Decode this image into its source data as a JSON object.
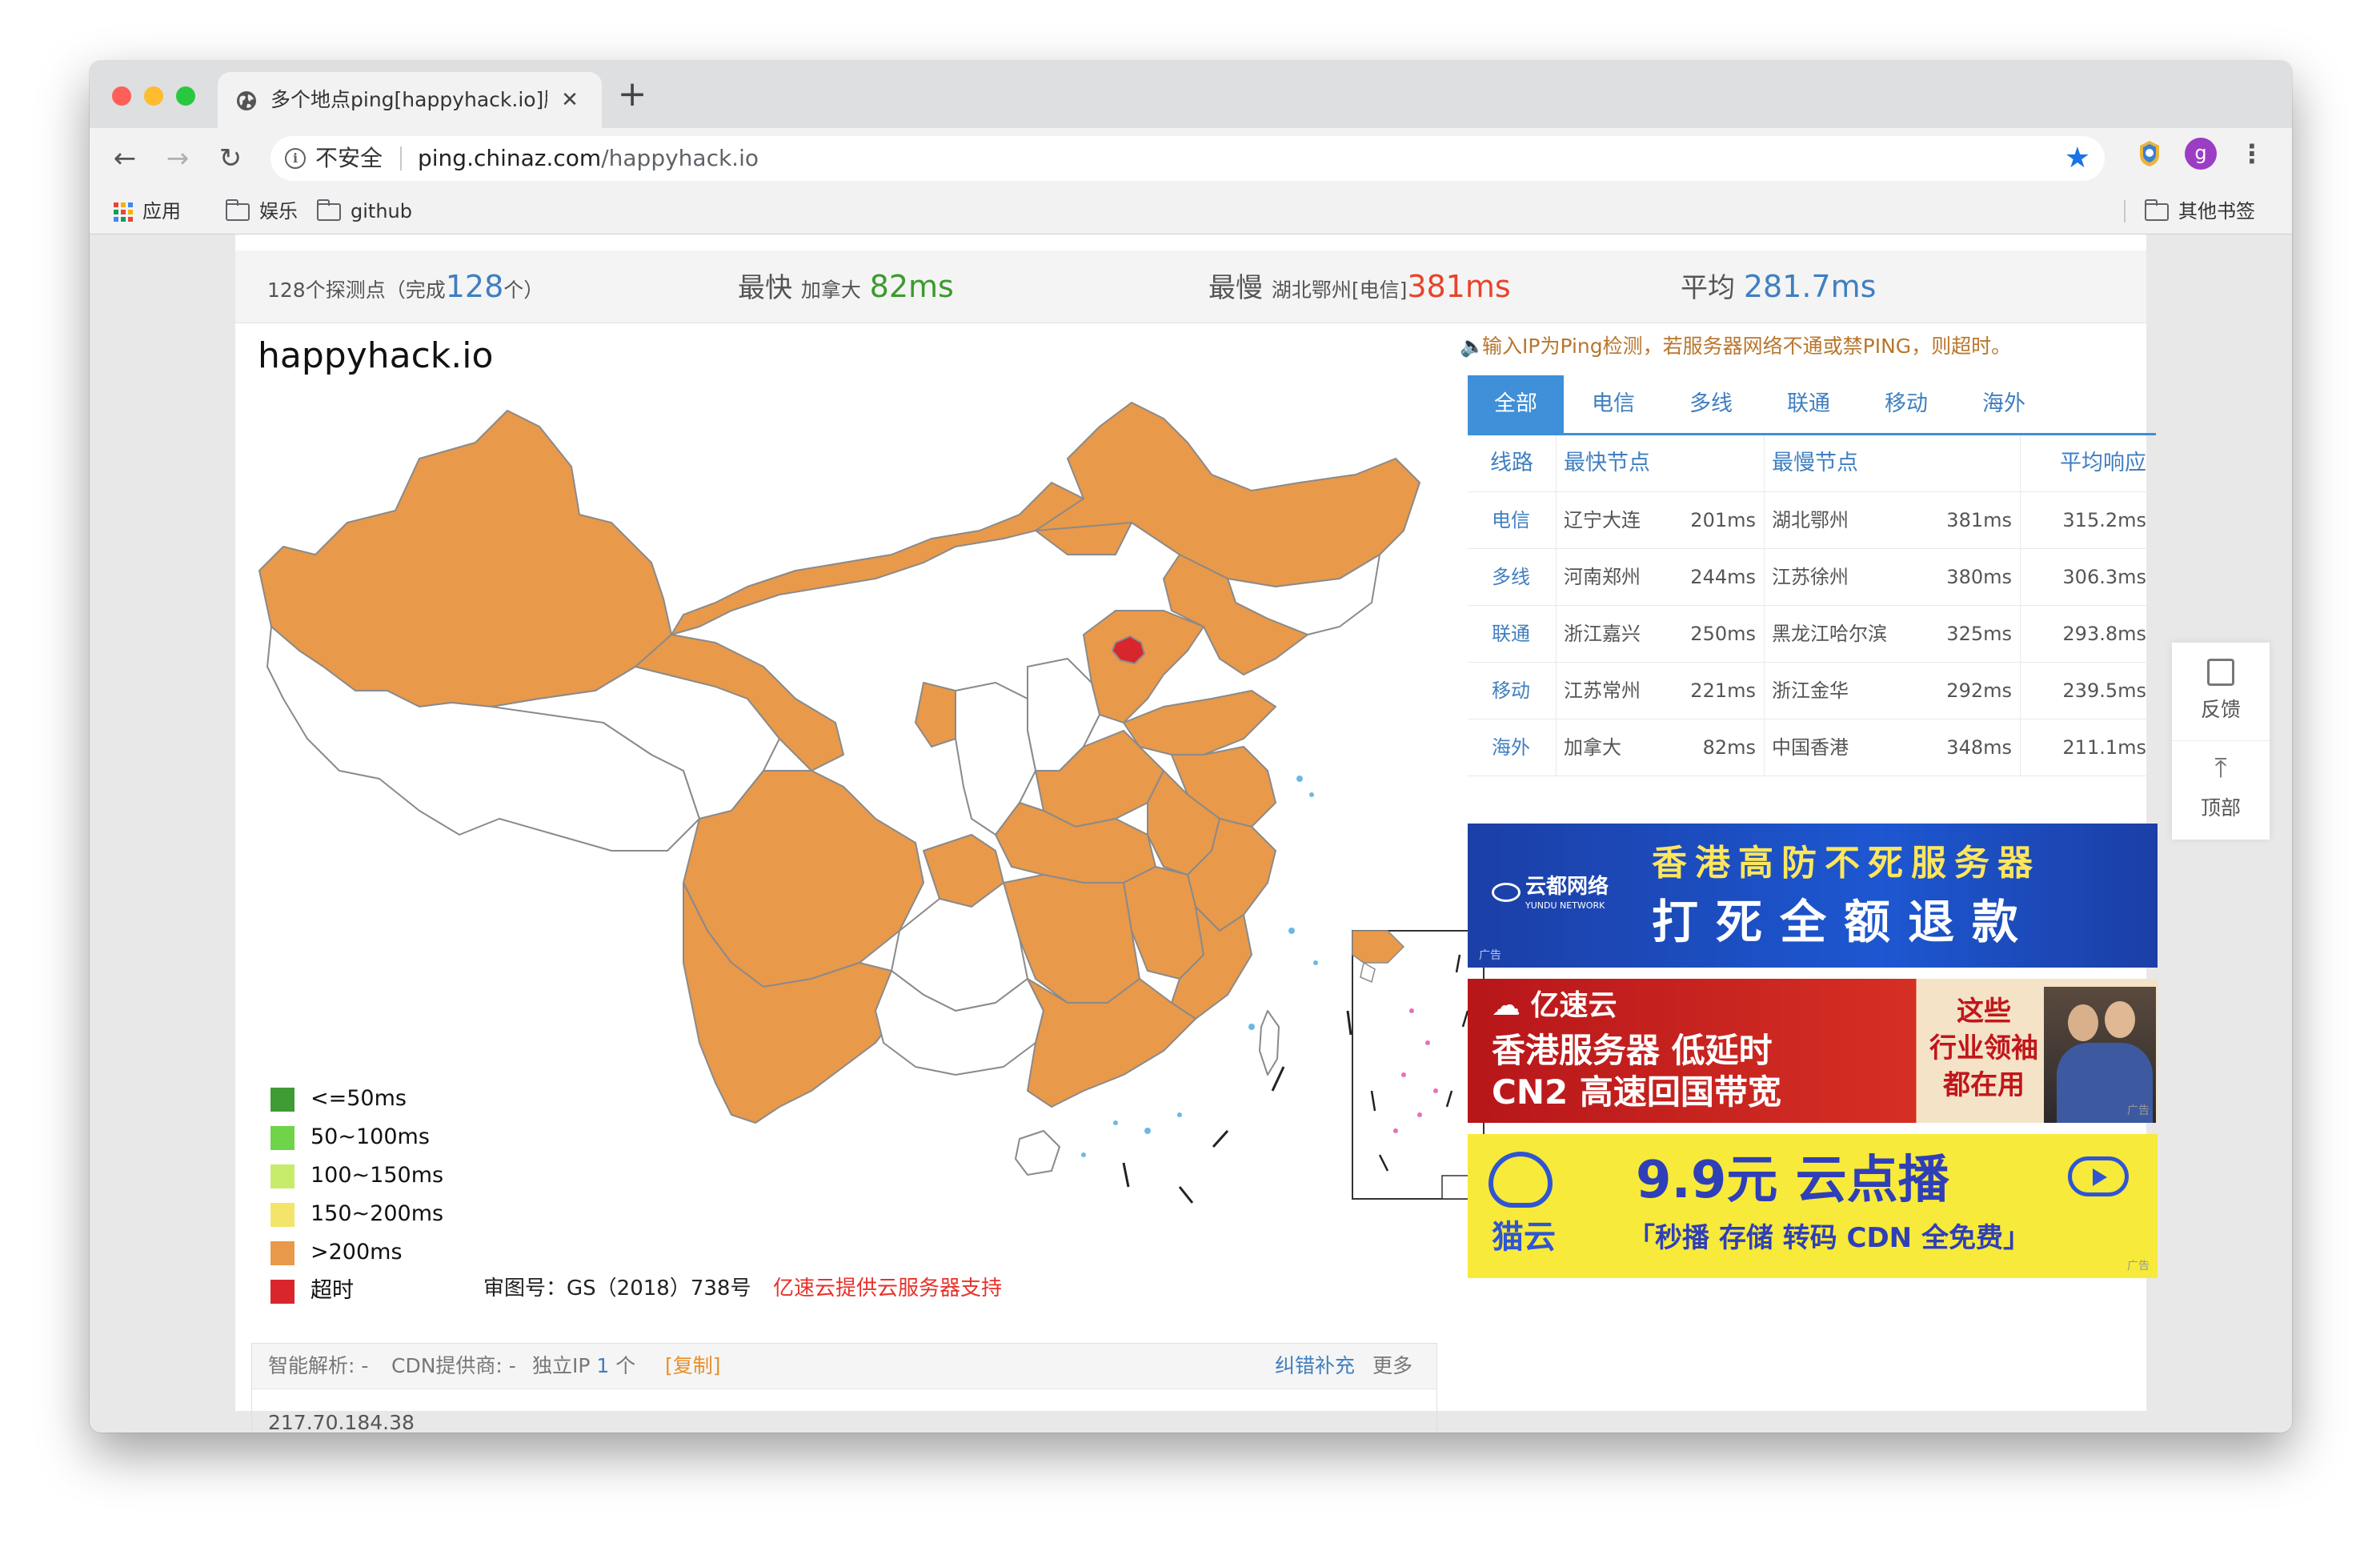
{
  "browser": {
    "tab_title": "多个地点ping[happyhack.io]服务",
    "url_insecure": "不安全",
    "url_host": "ping.chinaz.com",
    "url_path": "/happyhack.io",
    "avatar_letter": "g",
    "bookmarks": [
      "应用",
      "娱乐",
      "github"
    ],
    "other_bookmarks": "其他书签"
  },
  "stats": {
    "probes_prefix": "128个探测点（完成",
    "probes_done": "128",
    "probes_suffix": "个）",
    "fastest_label": "最快",
    "fastest_loc": "加拿大",
    "fastest_ms": "82ms",
    "slowest_label": "最慢",
    "slowest_loc": "湖北鄂州[电信]",
    "slowest_ms": "381ms",
    "avg_label": "平均",
    "avg_ms": "281.7ms"
  },
  "map": {
    "title": "happyhack.io",
    "legend": [
      {
        "label": "<=50ms",
        "color": "#3f9c35"
      },
      {
        "label": "50~100ms",
        "color": "#6fd44a"
      },
      {
        "label": "100~150ms",
        "color": "#c7ec6a"
      },
      {
        "label": "150~200ms",
        "color": "#f3e56a"
      },
      {
        "label": ">200ms",
        "color": "#e9994a"
      },
      {
        "label": "超时",
        "color": "#d8262c"
      }
    ],
    "approval": "审图号：GS（2018）738号",
    "sponsor": "亿速云提供云服务器支持"
  },
  "info": {
    "dns_label": "智能解析: -",
    "cdn_label": "CDN提供商: -",
    "ip_prefix": "独立IP",
    "ip_count": "1",
    "ip_suffix": "个",
    "copy": "[复制]",
    "correct": "纠错补充",
    "more": "更多",
    "ip": "217.70.184.38"
  },
  "notice": "输入IP为Ping检测，若服务器网络不通或禁PING，则超时。",
  "tabs": [
    "全部",
    "电信",
    "多线",
    "联通",
    "移动",
    "海外"
  ],
  "table": {
    "headers": [
      "线路",
      "最快节点",
      "最慢节点",
      "平均响应"
    ],
    "rows": [
      {
        "line": "电信",
        "fast": "辽宁大连",
        "fast_ms": "201ms",
        "slow": "湖北鄂州",
        "slow_ms": "381ms",
        "avg": "315.2ms"
      },
      {
        "line": "多线",
        "fast": "河南郑州",
        "fast_ms": "244ms",
        "slow": "江苏徐州",
        "slow_ms": "380ms",
        "avg": "306.3ms"
      },
      {
        "line": "联通",
        "fast": "浙江嘉兴",
        "fast_ms": "250ms",
        "slow": "黑龙江哈尔滨",
        "slow_ms": "325ms",
        "avg": "293.8ms"
      },
      {
        "line": "移动",
        "fast": "江苏常州",
        "fast_ms": "221ms",
        "slow": "浙江金华",
        "slow_ms": "292ms",
        "avg": "239.5ms"
      },
      {
        "line": "海外",
        "fast": "加拿大",
        "fast_ms": "82ms",
        "slow": "中国香港",
        "slow_ms": "348ms",
        "avg": "211.1ms"
      }
    ]
  },
  "ads": {
    "ad_tag": "广告",
    "ad1_brand": "云都网络",
    "ad1_brand_en": "YUNDU NETWORK",
    "ad1_line1": "香港高防不死服务器",
    "ad1_line2": "打死全额退款",
    "ad2_brand": "亿速云",
    "ad2_line1": "香港服务器  低延时",
    "ad2_line2": "CN2 高速回国带宽",
    "ad2_side1": "这些",
    "ad2_side2": "行业领袖",
    "ad2_side3": "都在用",
    "ad3_brand": "猫云",
    "ad3_line1": "9.9元 云点播",
    "ad3_line2": "「秒播 存储 转码 CDN 全免费」"
  },
  "side": {
    "feedback": "反馈",
    "top": "顶部"
  },
  "colors": {
    "accent_blue": "#3f8fd9",
    "green": "#3a9b2c",
    "red": "#e8432a",
    "orange_map": "#e9994a"
  }
}
